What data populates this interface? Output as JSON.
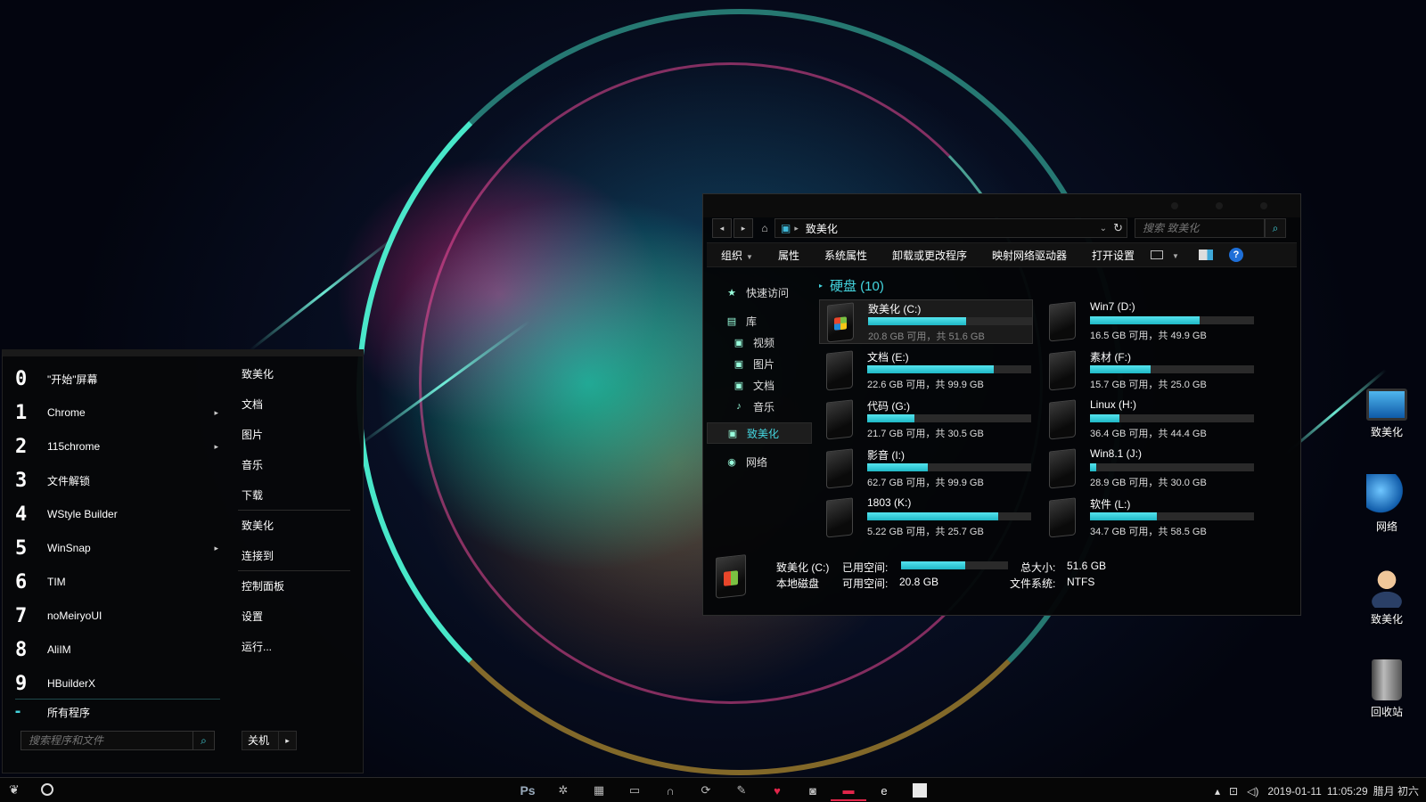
{
  "start_menu": {
    "pinned": [
      {
        "num": "0",
        "label": "\"开始\"屏幕",
        "has_arrow": false
      },
      {
        "num": "1",
        "label": "Chrome",
        "has_arrow": true
      },
      {
        "num": "2",
        "label": "115chrome",
        "has_arrow": true
      },
      {
        "num": "3",
        "label": "文件解锁",
        "has_arrow": false
      },
      {
        "num": "4",
        "label": "WStyle Builder",
        "has_arrow": false
      },
      {
        "num": "5",
        "label": "WinSnap",
        "has_arrow": true
      },
      {
        "num": "6",
        "label": "TIM",
        "has_arrow": false
      },
      {
        "num": "7",
        "label": "noMeiryoUI",
        "has_arrow": false
      },
      {
        "num": "8",
        "label": "AliIM",
        "has_arrow": false
      },
      {
        "num": "9",
        "label": "HBuilderX",
        "has_arrow": false
      }
    ],
    "all_programs": "所有程序",
    "search_placeholder": "搜索程序和文件",
    "places": [
      "致美化",
      "文档",
      "图片",
      "音乐",
      "下载",
      "致美化",
      "连接到",
      "控制面板",
      "设置",
      "运行..."
    ],
    "shutdown_label": "关机"
  },
  "explorer": {
    "breadcrumb": "致美化",
    "search_placeholder": "搜索 致美化",
    "toolbar": [
      "组织",
      "属性",
      "系统属性",
      "卸载或更改程序",
      "映射网络驱动器",
      "打开设置"
    ],
    "nav": [
      {
        "icon": "star-icon",
        "glyph": "★",
        "label": "快速访问",
        "indent": 0
      },
      {
        "icon": "library-icon",
        "glyph": "▤",
        "label": "库",
        "indent": 0
      },
      {
        "icon": "video-icon",
        "glyph": "▣",
        "label": "视频",
        "indent": 1
      },
      {
        "icon": "picture-icon",
        "glyph": "▣",
        "label": "图片",
        "indent": 1
      },
      {
        "icon": "document-icon",
        "glyph": "▣",
        "label": "文档",
        "indent": 1
      },
      {
        "icon": "music-icon",
        "glyph": "♪",
        "label": "音乐",
        "indent": 1
      },
      {
        "icon": "computer-icon",
        "glyph": "▣",
        "label": "致美化",
        "indent": 0,
        "selected": true
      },
      {
        "icon": "network-icon",
        "glyph": "◉",
        "label": "网络",
        "indent": 0
      }
    ],
    "drives_header": "硬盘 (10)",
    "drives": [
      {
        "name": "致美化 (C:)",
        "info": "20.8 GB 可用，共 51.6 GB",
        "used_pct": 60,
        "selected": true,
        "system": true
      },
      {
        "name": "Win7 (D:)",
        "info": "16.5 GB 可用，共 49.9 GB",
        "used_pct": 67
      },
      {
        "name": "文档 (E:)",
        "info": "22.6 GB 可用，共 99.9 GB",
        "used_pct": 77
      },
      {
        "name": "素材 (F:)",
        "info": "15.7 GB 可用，共 25.0 GB",
        "used_pct": 37
      },
      {
        "name": "代码 (G:)",
        "info": "21.7 GB 可用，共 30.5 GB",
        "used_pct": 29
      },
      {
        "name": "Linux (H:)",
        "info": "36.4 GB 可用，共 44.4 GB",
        "used_pct": 18
      },
      {
        "name": "影音 (I:)",
        "info": "62.7 GB 可用，共 99.9 GB",
        "used_pct": 37
      },
      {
        "name": "Win8.1 (J:)",
        "info": "28.9 GB 可用，共 30.0 GB",
        "used_pct": 4
      },
      {
        "name": "1803 (K:)",
        "info": "5.22 GB 可用，共 25.7 GB",
        "used_pct": 80
      },
      {
        "name": "软件 (L:)",
        "info": "34.7 GB 可用，共 58.5 GB",
        "used_pct": 41
      }
    ],
    "details": {
      "name": "致美化 (C:)",
      "type": "本地磁盘",
      "used_label": "已用空间:",
      "free_label": "可用空间:",
      "free_value": "20.8 GB",
      "used_pct": 60,
      "total_label": "总大小:",
      "total_value": "51.6 GB",
      "fs_label": "文件系统:",
      "fs_value": "NTFS"
    }
  },
  "desktop_icons": [
    {
      "icon": "computer-icon",
      "label": "致美化"
    },
    {
      "icon": "network-icon",
      "label": "网络"
    },
    {
      "icon": "user-icon",
      "label": "致美化"
    },
    {
      "icon": "recycle-bin-icon",
      "label": "回收站"
    }
  ],
  "taskbar": {
    "apps": [
      {
        "icon": "photoshop-icon",
        "glyph": "Ps"
      },
      {
        "icon": "gear-icon",
        "glyph": "✲"
      },
      {
        "icon": "grid-icon",
        "glyph": "▦"
      },
      {
        "icon": "window-icon",
        "glyph": "▭"
      },
      {
        "icon": "headphones-icon",
        "glyph": "∩"
      },
      {
        "icon": "refresh-icon",
        "glyph": "⟳"
      },
      {
        "icon": "notepad-icon",
        "glyph": "✎"
      },
      {
        "icon": "heart-icon",
        "glyph": "♥"
      },
      {
        "icon": "camera-icon",
        "glyph": "◙"
      },
      {
        "icon": "monitor-icon",
        "glyph": "▬",
        "active": true
      },
      {
        "icon": "edge-icon",
        "glyph": "e"
      },
      {
        "icon": "blank-app-icon",
        "glyph": ""
      }
    ],
    "date": "2019-01-11",
    "time": "11:05:29",
    "lunar": "腊月 初六"
  }
}
